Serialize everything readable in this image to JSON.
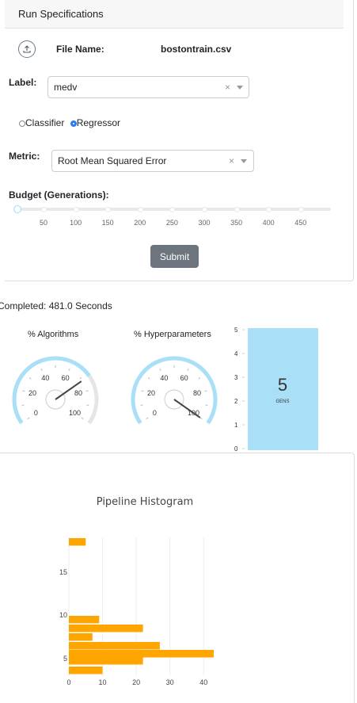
{
  "header": {
    "title": "Run Specifications"
  },
  "file": {
    "label": "File Name:",
    "value": "bostontrain.csv",
    "upload_icon": "upload-icon"
  },
  "label_field": {
    "label": "Label:",
    "value": "medv"
  },
  "model_type": {
    "options": [
      "Classifier",
      "Regressor"
    ],
    "selected": "Regressor"
  },
  "metric_field": {
    "label": "Metric:",
    "value": "Root Mean Squared Error"
  },
  "budget": {
    "label": "Budget (Generations):",
    "value": 0,
    "marks": [
      "50",
      "100",
      "150",
      "200",
      "250",
      "300",
      "350",
      "400",
      "450"
    ]
  },
  "submit": {
    "label": "Submit"
  },
  "status": {
    "completed_text": "Completed: 481.0 Seconds"
  },
  "gauges": [
    {
      "title": "% Algorithms",
      "value": 72,
      "ticks": [
        "0",
        "20",
        "40",
        "60",
        "80",
        "100"
      ]
    },
    {
      "title": "% Hyperparameters",
      "value": 100,
      "ticks": [
        "0",
        "20",
        "40",
        "60",
        "80",
        "100"
      ]
    }
  ],
  "gens": {
    "value": "5",
    "unit": "GENS",
    "scale": [
      "5",
      "4",
      "3",
      "2",
      "1",
      "0"
    ],
    "fill_color": "#aadff8"
  },
  "colors": {
    "accent": "#2f7bf5",
    "gauge_arc": "#aadff8",
    "bar": "#ffa500",
    "button": "#6c757d"
  },
  "chart_data": {
    "type": "bar",
    "orientation": "horizontal",
    "title": "Pipeline Histogram",
    "categories": [
      4,
      5,
      6,
      7,
      8,
      9,
      18
    ],
    "values": [
      10,
      22,
      43,
      27,
      7,
      22,
      9,
      5
    ],
    "rows": [
      {
        "y": 4,
        "x": 10
      },
      {
        "y": 5,
        "x": 22
      },
      {
        "y": 5.5,
        "x": 43
      },
      {
        "y": 6,
        "x": 27
      },
      {
        "y": 7,
        "x": 7
      },
      {
        "y": 8,
        "x": 22
      },
      {
        "y": 9,
        "x": 9
      },
      {
        "y": 18,
        "x": 5
      }
    ],
    "xticks": [
      "0",
      "10",
      "20",
      "30",
      "40"
    ],
    "yticks": [
      "5",
      "10",
      "15"
    ],
    "xlim": [
      0,
      45
    ],
    "ylim": [
      3.5,
      18.5
    ],
    "xlabel": "",
    "ylabel": "",
    "grid": true
  }
}
